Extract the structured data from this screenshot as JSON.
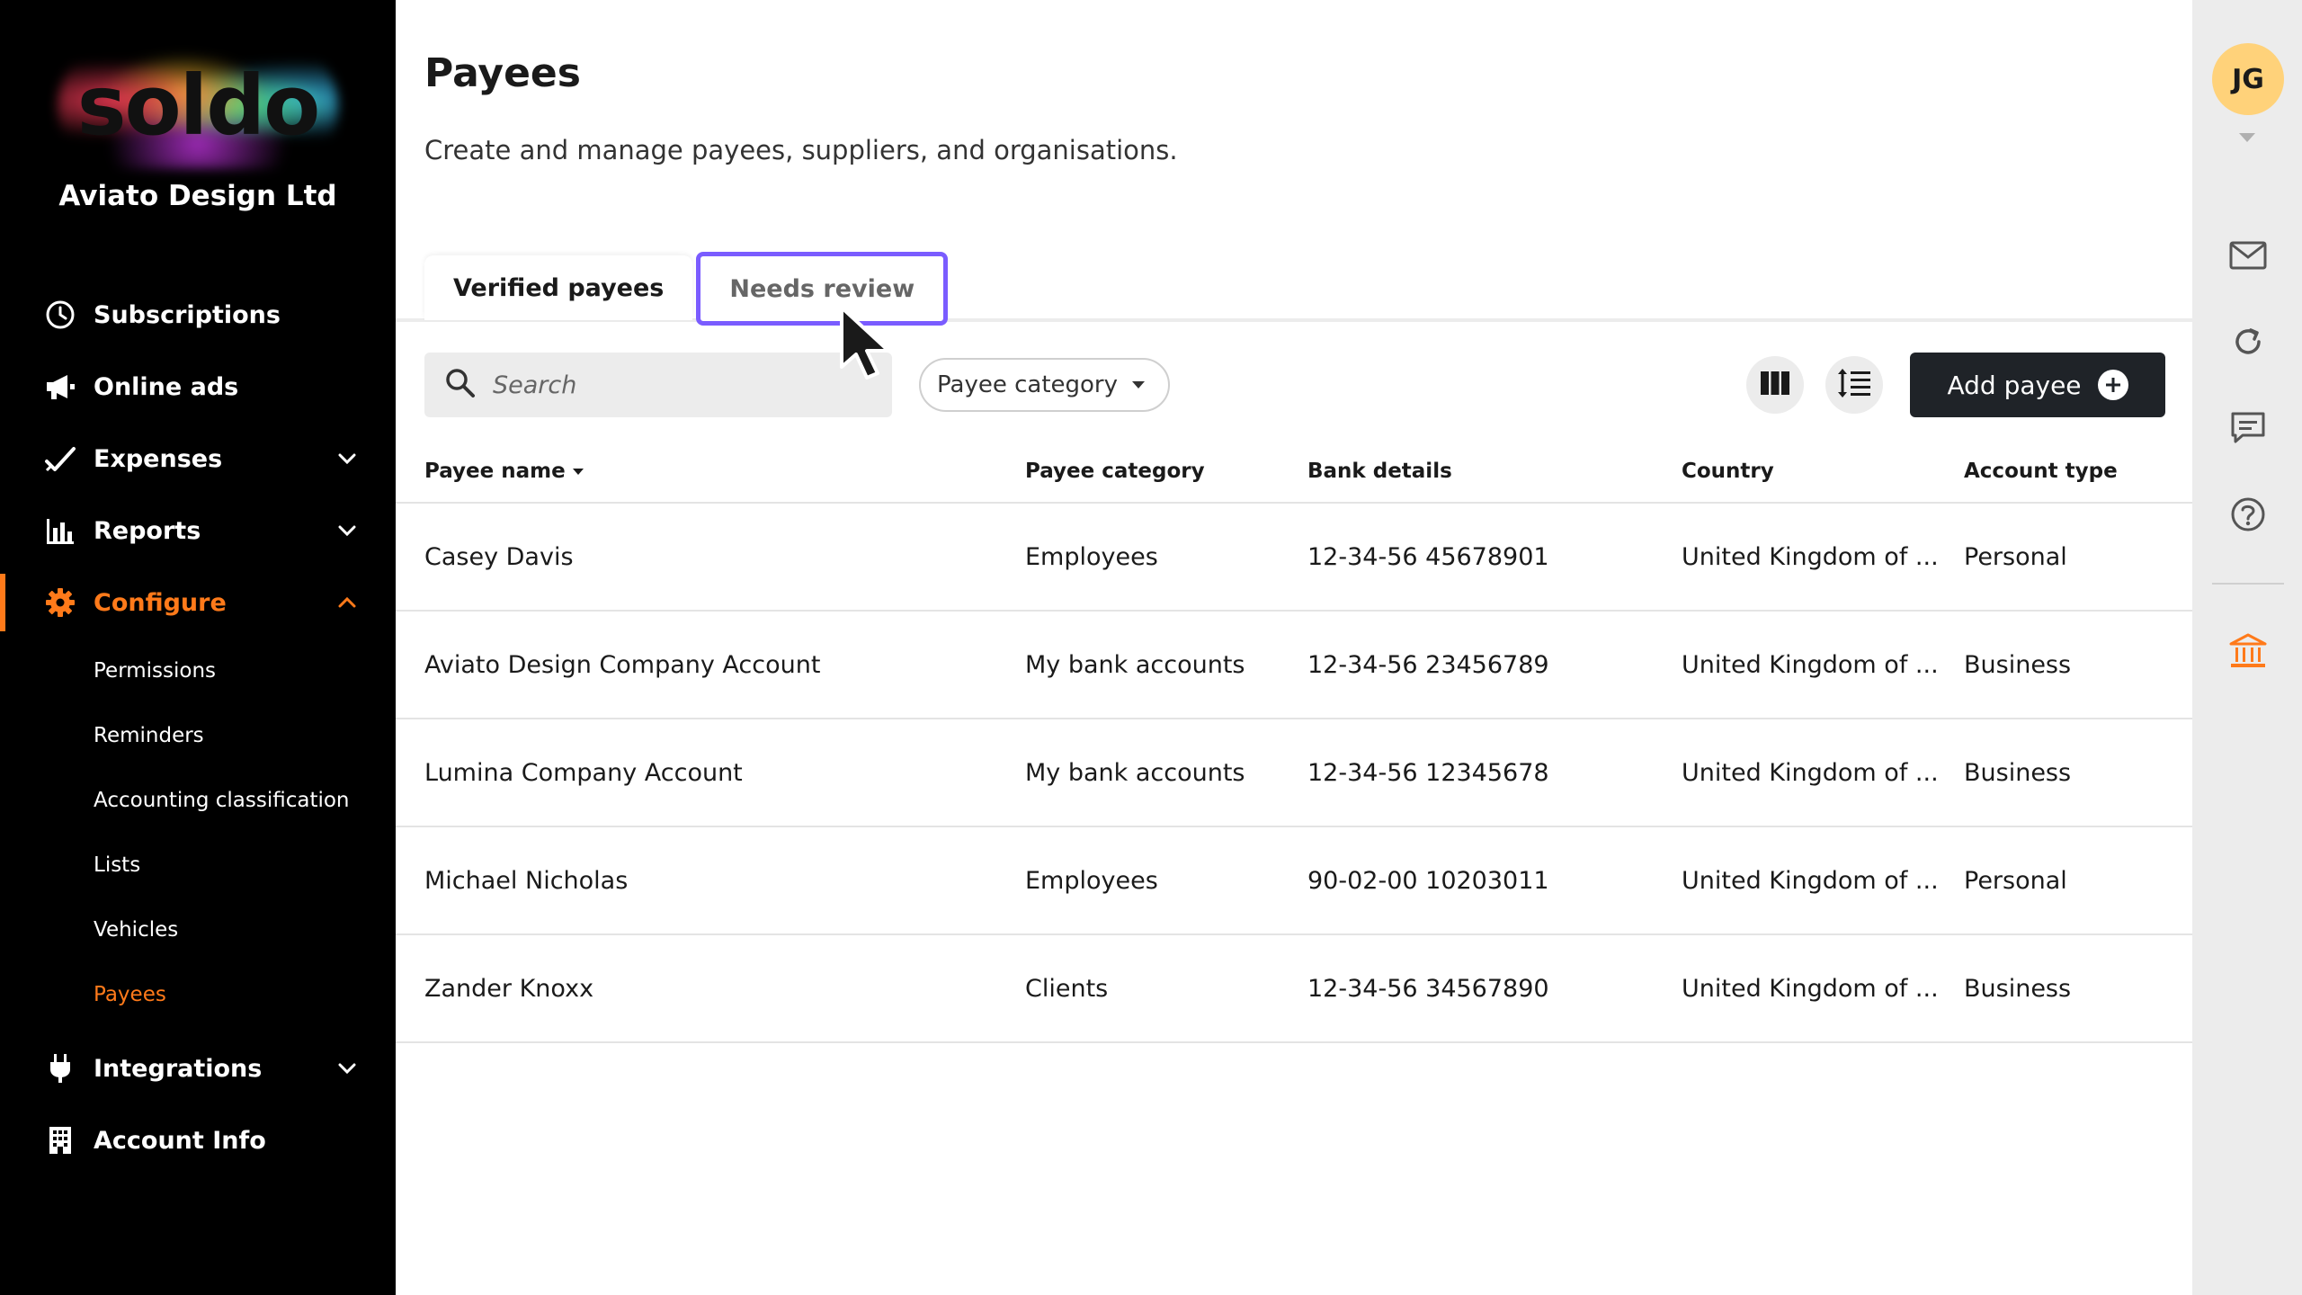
{
  "sidebar": {
    "logo_text": "soldo",
    "company": "Aviato Design Ltd",
    "items": [
      {
        "label": "Subscriptions",
        "icon": "clock-icon"
      },
      {
        "label": "Online ads",
        "icon": "megaphone-icon"
      },
      {
        "label": "Expenses",
        "icon": "check-icon"
      },
      {
        "label": "Reports",
        "icon": "bar-chart-icon"
      },
      {
        "label": "Configure",
        "icon": "gear-icon"
      },
      {
        "label": "Integrations",
        "icon": "plug-icon"
      },
      {
        "label": "Account Info",
        "icon": "building-icon"
      }
    ],
    "configure_sub": [
      "Permissions",
      "Reminders",
      "Accounting classification",
      "Lists",
      "Vehicles",
      "Payees"
    ],
    "accent_color": "#ff7a1a"
  },
  "main": {
    "title": "Payees",
    "subtitle": "Create and manage payees, suppliers, and organisations.",
    "tabs": [
      {
        "label": "Verified payees"
      },
      {
        "label": "Needs review"
      }
    ],
    "search_placeholder": "Search",
    "filter_label": "Payee category",
    "add_button_label": "Add payee"
  },
  "table": {
    "headers": [
      "Payee name",
      "Payee category",
      "Bank details",
      "Country",
      "Account type"
    ],
    "rows": [
      [
        "Casey Davis",
        "Employees",
        "12-34-56 45678901",
        "United Kingdom of ...",
        "Personal"
      ],
      [
        "Aviato Design Company Account",
        "My bank accounts",
        "12-34-56 23456789",
        "United Kingdom of ...",
        "Business"
      ],
      [
        "Lumina Company Account",
        "My bank accounts",
        "12-34-56 12345678",
        "United Kingdom of ...",
        "Business"
      ],
      [
        "Michael Nicholas",
        "Employees",
        "90-02-00 10203011",
        "United Kingdom of ...",
        "Personal"
      ],
      [
        "Zander Knoxx",
        "Clients",
        "12-34-56 34567890",
        "United Kingdom of ...",
        "Business"
      ]
    ]
  },
  "rail": {
    "avatar_initials": "JG",
    "icons": [
      "mail-icon",
      "refresh-icon",
      "chat-icon",
      "help-icon",
      "bank-icon"
    ]
  }
}
